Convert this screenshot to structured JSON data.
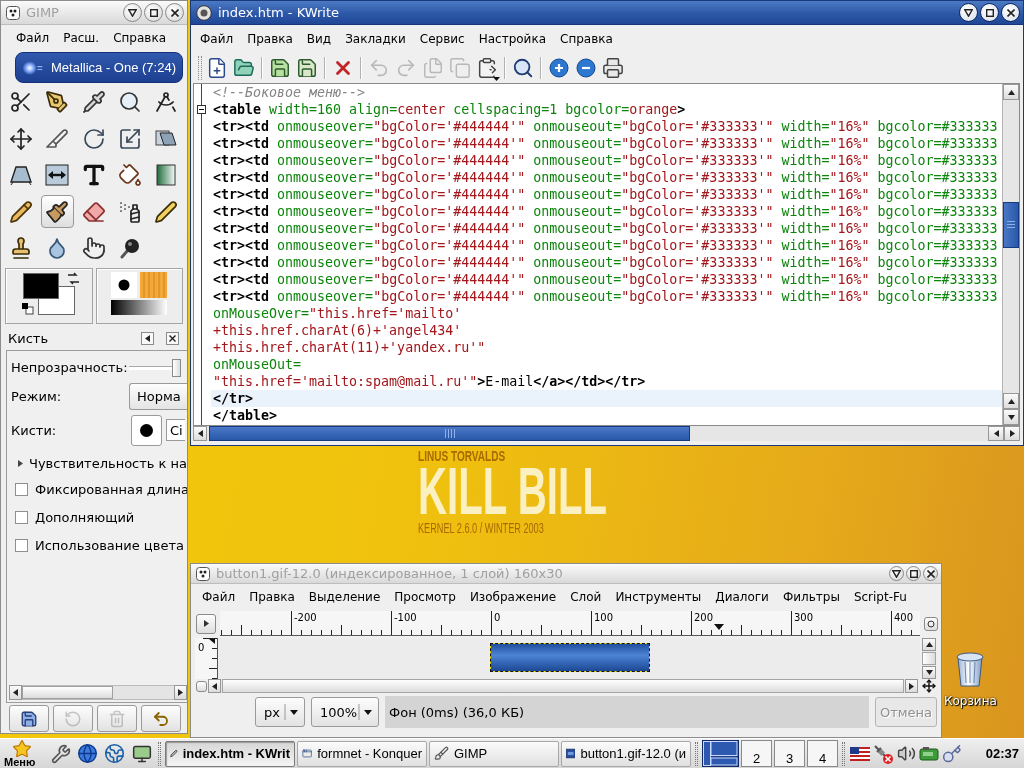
{
  "toolbox": {
    "title": "GIMP",
    "active": false,
    "menu": [
      "Файл",
      "Расш.",
      "Справка"
    ],
    "now_playing": "Metallica - One (7:24)",
    "tools": [
      {
        "selected": false
      },
      {
        "selected": false
      },
      {
        "selected": false
      },
      {
        "selected": false
      },
      {
        "selected": false
      },
      {
        "selected": false
      },
      {
        "selected": false
      },
      {
        "selected": false
      },
      {
        "selected": false
      },
      {
        "selected": false
      },
      {
        "selected": false
      },
      {
        "selected": false
      },
      {
        "selected": false
      },
      {
        "selected": false
      },
      {
        "selected": false
      },
      {
        "selected": false
      },
      {
        "selected": true
      },
      {
        "selected": false
      },
      {
        "selected": false
      },
      {
        "selected": false
      },
      {
        "selected": false
      },
      {
        "selected": false
      },
      {
        "selected": false
      },
      {
        "selected": false
      }
    ],
    "tool_options": {
      "title": "Кисть",
      "opacity": {
        "label": "Непрозрачность:",
        "level": 1
      },
      "mode": {
        "label": "Режим:",
        "value": "Норма"
      },
      "brush": {
        "label": "Кисти:",
        "value": "Ci"
      },
      "expander": {
        "label": "Чувствительность к на",
        "expanded": false
      },
      "options": [
        {
          "label": "Фиксированная длина",
          "checked": false
        },
        {
          "label": "Дополняющий",
          "checked": false
        },
        {
          "label": "Использование цвета",
          "checked": false
        }
      ],
      "buttons": [
        {
          "disabled": false
        },
        {
          "disabled": true
        },
        {
          "disabled": true
        },
        {
          "disabled": false
        }
      ]
    }
  },
  "editor": {
    "title": "index.htm - KWrite",
    "active": true,
    "menu": [
      "Файл",
      "Правка",
      "Вид",
      "Закладки",
      "Сервис",
      "Настройка",
      "Справка"
    ],
    "toolbar": [
      {
        "disabled": false
      },
      {
        "disabled": false
      },
      {
        "disabled": false
      },
      {
        "disabled": false
      },
      {
        "disabled": false
      },
      {
        "disabled": true
      },
      {
        "disabled": true
      },
      {
        "disabled": true
      },
      {
        "disabled": true
      },
      {
        "disabled": false
      },
      {
        "disabled": false
      },
      {
        "disabled": false
      },
      {
        "disabled": false
      },
      {
        "disabled": false
      }
    ],
    "lines": [
      {
        "fold": false,
        "current": false,
        "tokens": [
          {
            "kind": "comment",
            "text": "<!--Боковое меню-->"
          }
        ]
      },
      {
        "fold": true,
        "current": false,
        "tokens": [
          {
            "kind": "tag",
            "text": "<table"
          },
          {
            "kind": "attr",
            "text": " width=160 align="
          },
          {
            "kind": "value",
            "text": "center"
          },
          {
            "kind": "attr",
            "text": " cellspacing=1 bgcolor="
          },
          {
            "kind": "value",
            "text": "orange"
          },
          {
            "kind": "tag",
            "text": ">"
          }
        ]
      },
      {
        "fold": false,
        "current": false,
        "tokens": [
          {
            "kind": "tag",
            "text": "<tr><td"
          },
          {
            "kind": "attr",
            "text": " onmouseover="
          },
          {
            "kind": "value",
            "text": "\"bgColor='#444444'\""
          },
          {
            "kind": "attr",
            "text": " onmouseout="
          },
          {
            "kind": "value",
            "text": "\"bgColor='#333333'\""
          },
          {
            "kind": "attr",
            "text": " width="
          },
          {
            "kind": "value",
            "text": "\"16%\""
          },
          {
            "kind": "attr",
            "text": " bgcolor=#333333"
          }
        ]
      },
      {
        "fold": false,
        "current": false,
        "tokens": [
          {
            "kind": "tag",
            "text": "<tr><td"
          },
          {
            "kind": "attr",
            "text": " onmouseover="
          },
          {
            "kind": "value",
            "text": "\"bgColor='#444444'\""
          },
          {
            "kind": "attr",
            "text": " onmouseout="
          },
          {
            "kind": "value",
            "text": "\"bgColor='#333333'\""
          },
          {
            "kind": "attr",
            "text": " width="
          },
          {
            "kind": "value",
            "text": "\"16%\""
          },
          {
            "kind": "attr",
            "text": " bgcolor=#333333"
          }
        ]
      },
      {
        "fold": false,
        "current": false,
        "tokens": [
          {
            "kind": "tag",
            "text": "<tr><td"
          },
          {
            "kind": "attr",
            "text": " onmouseover="
          },
          {
            "kind": "value",
            "text": "\"bgColor='#444444'\""
          },
          {
            "kind": "attr",
            "text": " onmouseout="
          },
          {
            "kind": "value",
            "text": "\"bgColor='#333333'\""
          },
          {
            "kind": "attr",
            "text": " width="
          },
          {
            "kind": "value",
            "text": "\"16%\""
          },
          {
            "kind": "attr",
            "text": " bgcolor=#333333"
          }
        ]
      },
      {
        "fold": false,
        "current": false,
        "tokens": [
          {
            "kind": "tag",
            "text": "<tr><td"
          },
          {
            "kind": "attr",
            "text": " onmouseover="
          },
          {
            "kind": "value",
            "text": "\"bgColor='#444444'\""
          },
          {
            "kind": "attr",
            "text": " onmouseout="
          },
          {
            "kind": "value",
            "text": "\"bgColor='#333333'\""
          },
          {
            "kind": "attr",
            "text": " width="
          },
          {
            "kind": "value",
            "text": "\"16%\""
          },
          {
            "kind": "attr",
            "text": " bgcolor=#333333"
          }
        ]
      },
      {
        "fold": false,
        "current": false,
        "tokens": [
          {
            "kind": "tag",
            "text": "<tr><td"
          },
          {
            "kind": "attr",
            "text": " onmouseover="
          },
          {
            "kind": "value",
            "text": "\"bgColor='#444444'\""
          },
          {
            "kind": "attr",
            "text": " onmouseout="
          },
          {
            "kind": "value",
            "text": "\"bgColor='#333333'\""
          },
          {
            "kind": "attr",
            "text": " width="
          },
          {
            "kind": "value",
            "text": "\"16%\""
          },
          {
            "kind": "attr",
            "text": " bgcolor=#333333"
          }
        ]
      },
      {
        "fold": false,
        "current": false,
        "tokens": [
          {
            "kind": "tag",
            "text": "<tr><td"
          },
          {
            "kind": "attr",
            "text": " onmouseover="
          },
          {
            "kind": "value",
            "text": "\"bgColor='#444444'\""
          },
          {
            "kind": "attr",
            "text": " onmouseout="
          },
          {
            "kind": "value",
            "text": "\"bgColor='#333333'\""
          },
          {
            "kind": "attr",
            "text": " width="
          },
          {
            "kind": "value",
            "text": "\"16%\""
          },
          {
            "kind": "attr",
            "text": " bgcolor=#333333"
          }
        ]
      },
      {
        "fold": false,
        "current": false,
        "tokens": [
          {
            "kind": "tag",
            "text": "<tr><td"
          },
          {
            "kind": "attr",
            "text": " onmouseover="
          },
          {
            "kind": "value",
            "text": "\"bgColor='#444444'\""
          },
          {
            "kind": "attr",
            "text": " onmouseout="
          },
          {
            "kind": "value",
            "text": "\"bgColor='#333333'\""
          },
          {
            "kind": "attr",
            "text": " width="
          },
          {
            "kind": "value",
            "text": "\"16%\""
          },
          {
            "kind": "attr",
            "text": " bgcolor=#333333"
          }
        ]
      },
      {
        "fold": false,
        "current": false,
        "tokens": [
          {
            "kind": "tag",
            "text": "<tr><td"
          },
          {
            "kind": "attr",
            "text": " onmouseover="
          },
          {
            "kind": "value",
            "text": "\"bgColor='#444444'\""
          },
          {
            "kind": "attr",
            "text": " onmouseout="
          },
          {
            "kind": "value",
            "text": "\"bgColor='#333333'\""
          },
          {
            "kind": "attr",
            "text": " width="
          },
          {
            "kind": "value",
            "text": "\"16%\""
          },
          {
            "kind": "attr",
            "text": " bgcolor=#333333"
          }
        ]
      },
      {
        "fold": false,
        "current": false,
        "tokens": [
          {
            "kind": "tag",
            "text": "<tr><td"
          },
          {
            "kind": "attr",
            "text": " onmouseover="
          },
          {
            "kind": "value",
            "text": "\"bgColor='#444444'\""
          },
          {
            "kind": "attr",
            "text": " onmouseout="
          },
          {
            "kind": "value",
            "text": "\"bgColor='#333333'\""
          },
          {
            "kind": "attr",
            "text": " width="
          },
          {
            "kind": "value",
            "text": "\"16%\""
          },
          {
            "kind": "attr",
            "text": " bgcolor=#333333"
          }
        ]
      },
      {
        "fold": false,
        "current": false,
        "tokens": [
          {
            "kind": "tag",
            "text": "<tr><td"
          },
          {
            "kind": "attr",
            "text": " onmouseover="
          },
          {
            "kind": "value",
            "text": "\"bgColor='#444444'\""
          },
          {
            "kind": "attr",
            "text": " onmouseout="
          },
          {
            "kind": "value",
            "text": "\"bgColor='#333333'\""
          },
          {
            "kind": "attr",
            "text": " width="
          },
          {
            "kind": "value",
            "text": "\"16%\""
          },
          {
            "kind": "attr",
            "text": " bgcolor=#333333"
          }
        ]
      },
      {
        "fold": false,
        "current": false,
        "tokens": [
          {
            "kind": "tag",
            "text": "<tr><td"
          },
          {
            "kind": "attr",
            "text": " onmouseover="
          },
          {
            "kind": "value",
            "text": "\"bgColor='#444444'\""
          },
          {
            "kind": "attr",
            "text": " onmouseout="
          },
          {
            "kind": "value",
            "text": "\"bgColor='#333333'\""
          },
          {
            "kind": "attr",
            "text": " width="
          },
          {
            "kind": "value",
            "text": "\"16%\""
          },
          {
            "kind": "attr",
            "text": " bgcolor=#333333"
          }
        ]
      },
      {
        "fold": false,
        "current": false,
        "tokens": [
          {
            "kind": "attr",
            "text": "onMouseOver="
          },
          {
            "kind": "value",
            "text": "\"this.href='mailto'"
          }
        ]
      },
      {
        "fold": false,
        "current": false,
        "tokens": [
          {
            "kind": "value",
            "text": "+this.href.charAt(6)+'angel434'"
          }
        ]
      },
      {
        "fold": false,
        "current": false,
        "tokens": [
          {
            "kind": "value",
            "text": "+this.href.charAt(11)+'yandex.ru'\""
          }
        ]
      },
      {
        "fold": false,
        "current": false,
        "tokens": [
          {
            "kind": "attr",
            "text": "onMouseOut="
          }
        ]
      },
      {
        "fold": false,
        "current": false,
        "tokens": [
          {
            "kind": "value",
            "text": "\"this.href='mailto:spam@mail.ru'\""
          },
          {
            "kind": "tag",
            "text": ">"
          },
          {
            "kind": "text",
            "text": "E-mail"
          },
          {
            "kind": "tag",
            "text": "</a></td></tr>"
          }
        ]
      },
      {
        "fold": false,
        "current": true,
        "tokens": [
          {
            "kind": "tag",
            "text": "</tr>"
          }
        ]
      },
      {
        "fold": false,
        "current": false,
        "tokens": [
          {
            "kind": "tag",
            "text": "</table>"
          }
        ]
      }
    ]
  },
  "wallpaper": {
    "subtitle": "LINUS TORVALDS",
    "title": "KILL BILL",
    "caption": "KERNEL 2.6.0 / WINTER 2003"
  },
  "image_window": {
    "title": "button1.gif-12.0 (индексированное, 1 слой) 160x30",
    "active": false,
    "menu": [
      "Файл",
      "Правка",
      "Выделение",
      "Просмотр",
      "Изображение",
      "Слой",
      "Инструменты",
      "Диалоги",
      "Фильтры",
      "Script-Fu"
    ],
    "ruler_labels": [
      "-200",
      "-100",
      "0",
      "100",
      "200",
      "300",
      "400"
    ],
    "vertical_ruler_labels": [
      "0"
    ],
    "unit": "px",
    "zoom": "100%",
    "status": "Фон (0ms) (36,0 КБ)",
    "cancel": {
      "label": "Отмена",
      "disabled": true
    }
  },
  "desktop_icons": [
    {
      "label": "Корзина"
    }
  ],
  "taskbar": {
    "menu": "Меню",
    "tasks": [
      {
        "label": "index.htm - KWrit",
        "selected": true
      },
      {
        "label": "formnet - Konquer",
        "selected": false
      },
      {
        "label": "GIMP",
        "selected": false
      },
      {
        "label": "button1.gif-12.0 (и",
        "selected": false
      }
    ],
    "desktops": [
      {
        "selected": true
      },
      {
        "label": "2",
        "selected": false
      },
      {
        "label": "3",
        "selected": false
      },
      {
        "label": "4",
        "selected": false
      }
    ],
    "clock": "02:37"
  }
}
